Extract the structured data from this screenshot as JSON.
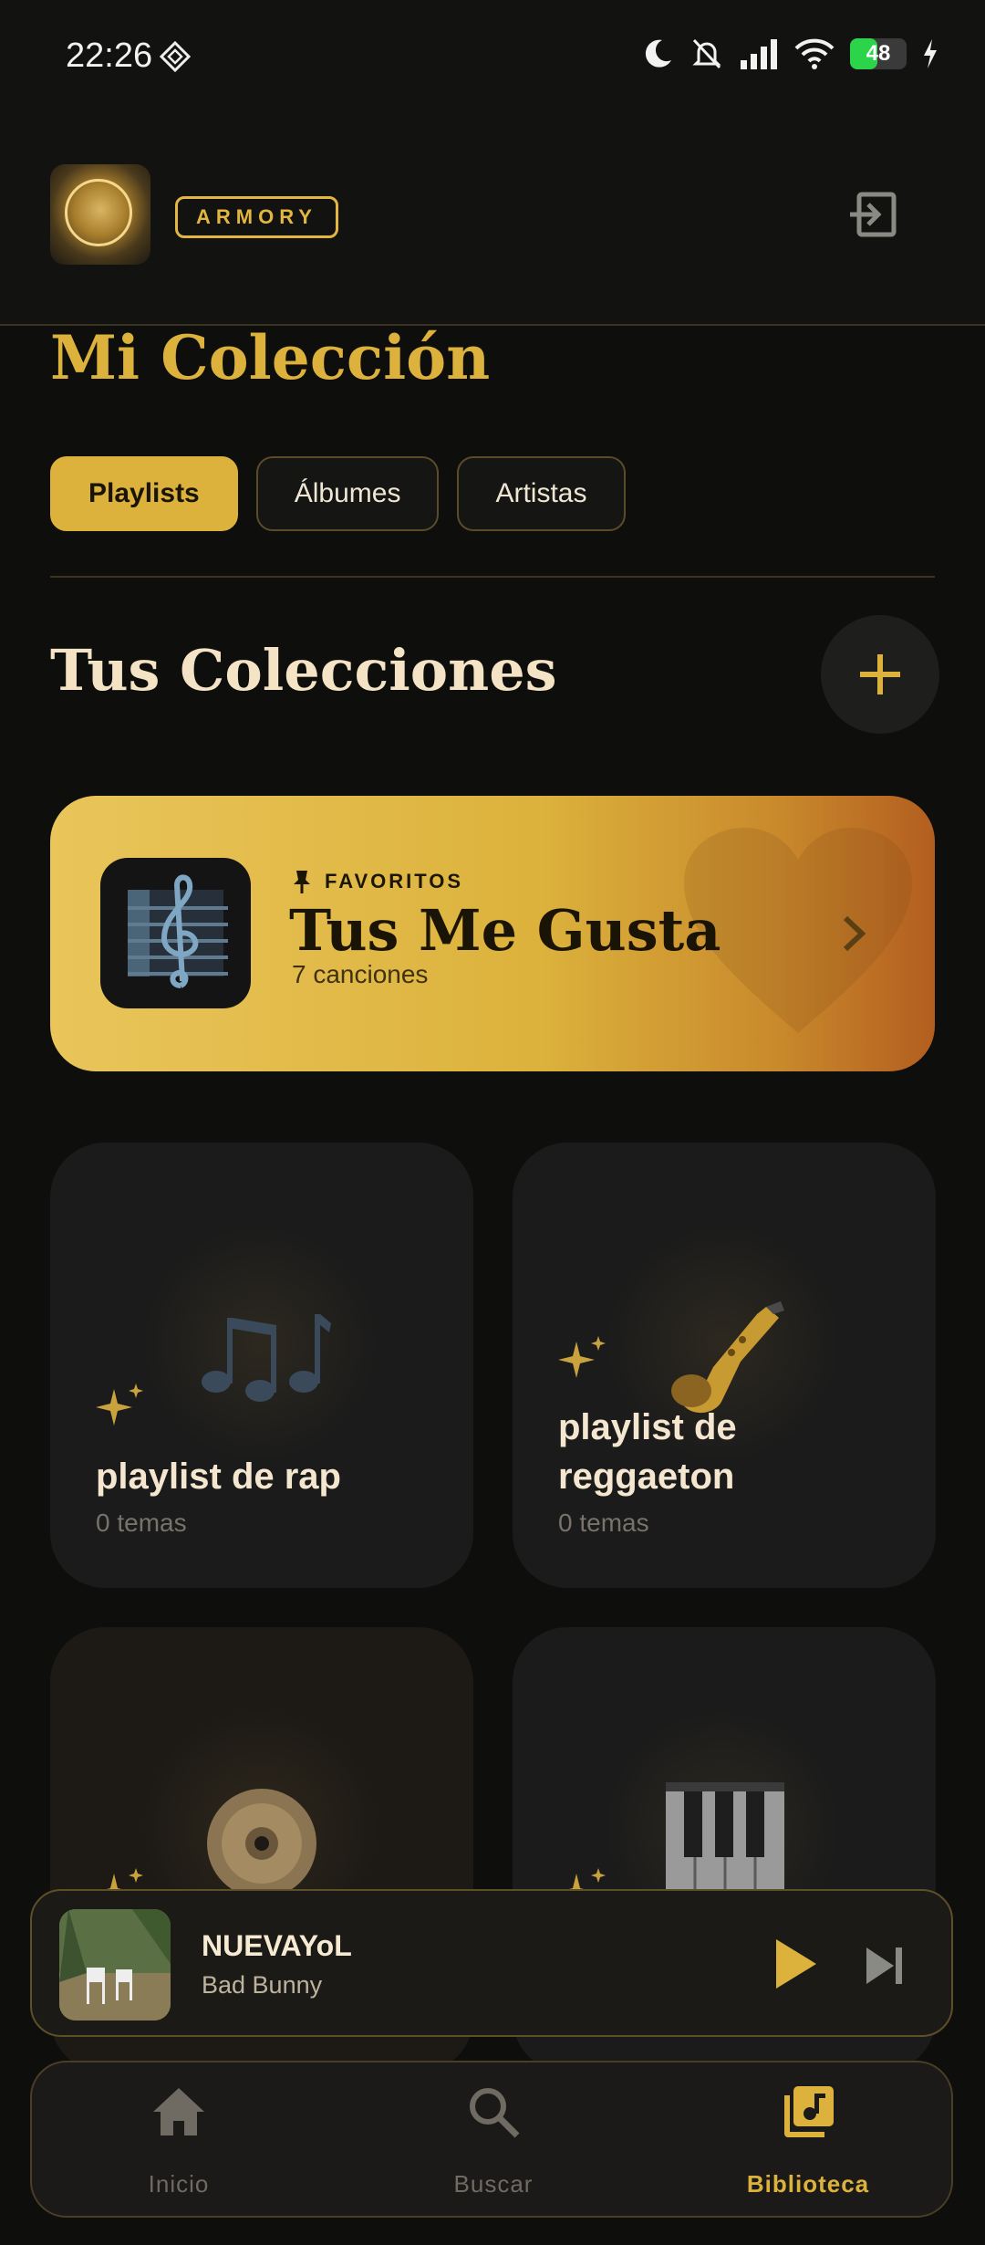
{
  "status_bar": {
    "time": "22:26",
    "battery": "48",
    "battery_level": 0.48
  },
  "header": {
    "brand": "ARMORY"
  },
  "page": {
    "title": "Mi Colección"
  },
  "tabs": [
    {
      "label": "Playlists",
      "active": true
    },
    {
      "label": "Álbumes",
      "active": false
    },
    {
      "label": "Artistas",
      "active": false
    }
  ],
  "section": {
    "title": "Tus Colecciones",
    "add_symbol": "+"
  },
  "favorites": {
    "label": "FAVORITOS",
    "title": "Tus Me Gusta",
    "count": "7 canciones"
  },
  "playlists": [
    {
      "name": "playlist de rap",
      "count": "0 temas",
      "icon": "musical-notes-icon"
    },
    {
      "name": "playlist de reggaeton",
      "count": "0 temas",
      "icon": "saxophone-icon"
    },
    {
      "name": "",
      "count": "",
      "icon": "cd-disc-icon"
    },
    {
      "name": "",
      "count": "",
      "icon": "piano-keys-icon"
    }
  ],
  "now_playing": {
    "title": "NUEVAYoL",
    "artist": "Bad Bunny"
  },
  "nav": [
    {
      "label": "Inicio",
      "icon": "home-icon",
      "active": false
    },
    {
      "label": "Buscar",
      "icon": "search-icon",
      "active": false
    },
    {
      "label": "Biblioteca",
      "icon": "library-icon",
      "active": true
    }
  ],
  "colors": {
    "accent": "#dcb23c",
    "background": "#0e0e0d",
    "card": "#1b1b1b"
  }
}
